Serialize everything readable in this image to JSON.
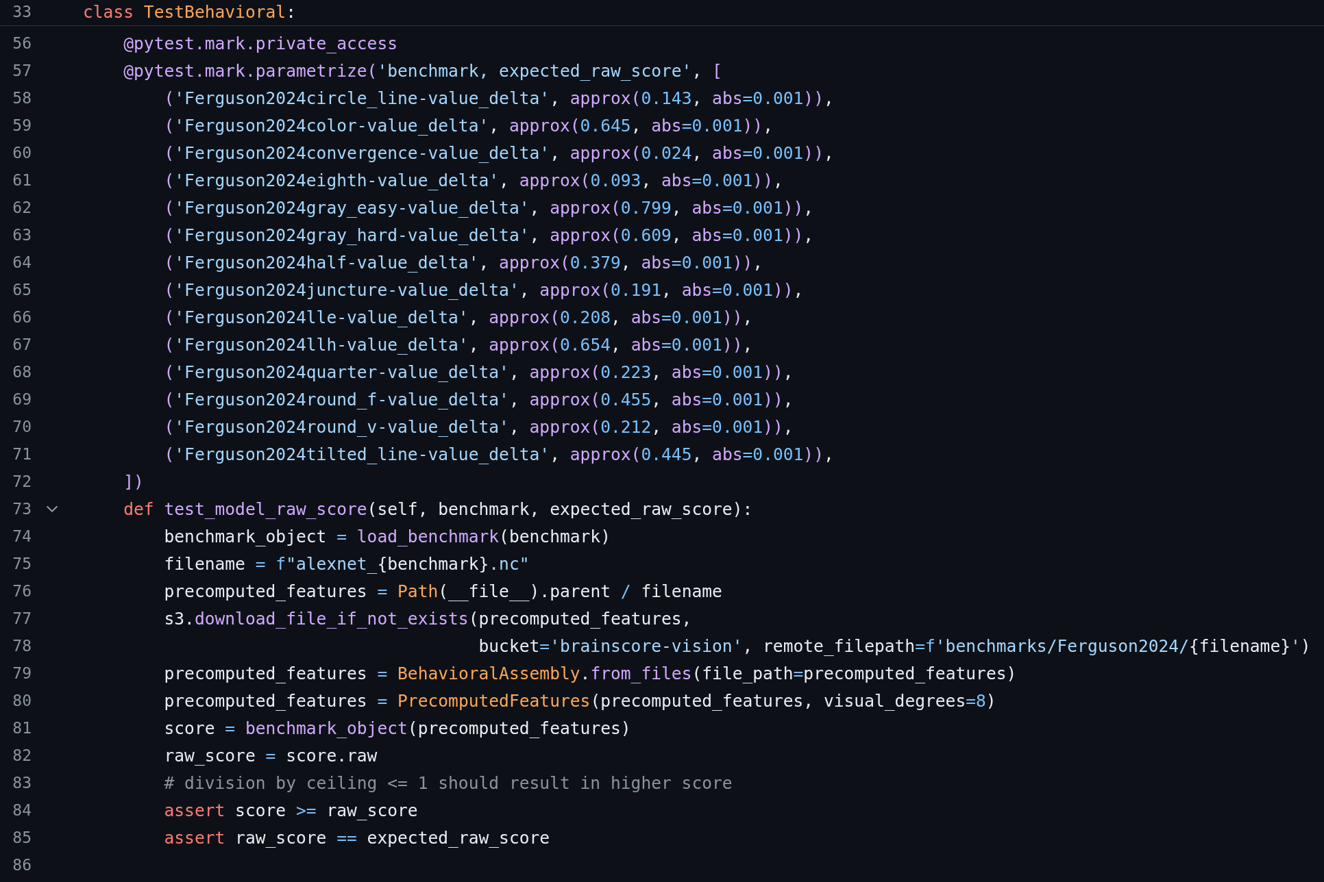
{
  "sticky_header": {
    "number": "33",
    "tokens": [
      {
        "kind": "kw",
        "text": "class "
      },
      {
        "kind": "type",
        "text": "TestBehavioral"
      },
      {
        "kind": "p",
        "text": ":"
      }
    ]
  },
  "lines": [
    {
      "number": "56",
      "tokens": [
        {
          "kind": "fn",
          "text": "    @pytest.mark.private_access"
        }
      ]
    },
    {
      "number": "57",
      "tokens": [
        {
          "kind": "fn",
          "text": "    @pytest.mark.parametrize("
        },
        {
          "kind": "str",
          "text": "'benchmark, expected_raw_score'"
        },
        {
          "kind": "p",
          "text": ", "
        },
        {
          "kind": "fn",
          "text": "["
        }
      ]
    },
    {
      "number": "58",
      "tokens": [
        {
          "kind": "fn",
          "text": "        ("
        },
        {
          "kind": "str",
          "text": "'Ferguson2024circle_line-value_delta'"
        },
        {
          "kind": "p",
          "text": ", "
        },
        {
          "kind": "fn",
          "text": "approx("
        },
        {
          "kind": "const",
          "text": "0.143"
        },
        {
          "kind": "p",
          "text": ", "
        },
        {
          "kind": "fn",
          "text": "abs"
        },
        {
          "kind": "const",
          "text": "=0.001"
        },
        {
          "kind": "fn",
          "text": "))"
        },
        {
          "kind": "p",
          "text": ","
        }
      ]
    },
    {
      "number": "59",
      "tokens": [
        {
          "kind": "fn",
          "text": "        ("
        },
        {
          "kind": "str",
          "text": "'Ferguson2024color-value_delta'"
        },
        {
          "kind": "p",
          "text": ", "
        },
        {
          "kind": "fn",
          "text": "approx("
        },
        {
          "kind": "const",
          "text": "0.645"
        },
        {
          "kind": "p",
          "text": ", "
        },
        {
          "kind": "fn",
          "text": "abs"
        },
        {
          "kind": "const",
          "text": "=0.001"
        },
        {
          "kind": "fn",
          "text": "))"
        },
        {
          "kind": "p",
          "text": ","
        }
      ]
    },
    {
      "number": "60",
      "tokens": [
        {
          "kind": "fn",
          "text": "        ("
        },
        {
          "kind": "str",
          "text": "'Ferguson2024convergence-value_delta'"
        },
        {
          "kind": "p",
          "text": ", "
        },
        {
          "kind": "fn",
          "text": "approx("
        },
        {
          "kind": "const",
          "text": "0.024"
        },
        {
          "kind": "p",
          "text": ", "
        },
        {
          "kind": "fn",
          "text": "abs"
        },
        {
          "kind": "const",
          "text": "=0.001"
        },
        {
          "kind": "fn",
          "text": "))"
        },
        {
          "kind": "p",
          "text": ","
        }
      ]
    },
    {
      "number": "61",
      "tokens": [
        {
          "kind": "fn",
          "text": "        ("
        },
        {
          "kind": "str",
          "text": "'Ferguson2024eighth-value_delta'"
        },
        {
          "kind": "p",
          "text": ", "
        },
        {
          "kind": "fn",
          "text": "approx("
        },
        {
          "kind": "const",
          "text": "0.093"
        },
        {
          "kind": "p",
          "text": ", "
        },
        {
          "kind": "fn",
          "text": "abs"
        },
        {
          "kind": "const",
          "text": "=0.001"
        },
        {
          "kind": "fn",
          "text": "))"
        },
        {
          "kind": "p",
          "text": ","
        }
      ]
    },
    {
      "number": "62",
      "tokens": [
        {
          "kind": "fn",
          "text": "        ("
        },
        {
          "kind": "str",
          "text": "'Ferguson2024gray_easy-value_delta'"
        },
        {
          "kind": "p",
          "text": ", "
        },
        {
          "kind": "fn",
          "text": "approx("
        },
        {
          "kind": "const",
          "text": "0.799"
        },
        {
          "kind": "p",
          "text": ", "
        },
        {
          "kind": "fn",
          "text": "abs"
        },
        {
          "kind": "const",
          "text": "=0.001"
        },
        {
          "kind": "fn",
          "text": "))"
        },
        {
          "kind": "p",
          "text": ","
        }
      ]
    },
    {
      "number": "63",
      "tokens": [
        {
          "kind": "fn",
          "text": "        ("
        },
        {
          "kind": "str",
          "text": "'Ferguson2024gray_hard-value_delta'"
        },
        {
          "kind": "p",
          "text": ", "
        },
        {
          "kind": "fn",
          "text": "approx("
        },
        {
          "kind": "const",
          "text": "0.609"
        },
        {
          "kind": "p",
          "text": ", "
        },
        {
          "kind": "fn",
          "text": "abs"
        },
        {
          "kind": "const",
          "text": "=0.001"
        },
        {
          "kind": "fn",
          "text": "))"
        },
        {
          "kind": "p",
          "text": ","
        }
      ]
    },
    {
      "number": "64",
      "tokens": [
        {
          "kind": "fn",
          "text": "        ("
        },
        {
          "kind": "str",
          "text": "'Ferguson2024half-value_delta'"
        },
        {
          "kind": "p",
          "text": ", "
        },
        {
          "kind": "fn",
          "text": "approx("
        },
        {
          "kind": "const",
          "text": "0.379"
        },
        {
          "kind": "p",
          "text": ", "
        },
        {
          "kind": "fn",
          "text": "abs"
        },
        {
          "kind": "const",
          "text": "=0.001"
        },
        {
          "kind": "fn",
          "text": "))"
        },
        {
          "kind": "p",
          "text": ","
        }
      ]
    },
    {
      "number": "65",
      "tokens": [
        {
          "kind": "fn",
          "text": "        ("
        },
        {
          "kind": "str",
          "text": "'Ferguson2024juncture-value_delta'"
        },
        {
          "kind": "p",
          "text": ", "
        },
        {
          "kind": "fn",
          "text": "approx("
        },
        {
          "kind": "const",
          "text": "0.191"
        },
        {
          "kind": "p",
          "text": ", "
        },
        {
          "kind": "fn",
          "text": "abs"
        },
        {
          "kind": "const",
          "text": "=0.001"
        },
        {
          "kind": "fn",
          "text": "))"
        },
        {
          "kind": "p",
          "text": ","
        }
      ]
    },
    {
      "number": "66",
      "tokens": [
        {
          "kind": "fn",
          "text": "        ("
        },
        {
          "kind": "str",
          "text": "'Ferguson2024lle-value_delta'"
        },
        {
          "kind": "p",
          "text": ", "
        },
        {
          "kind": "fn",
          "text": "approx("
        },
        {
          "kind": "const",
          "text": "0.208"
        },
        {
          "kind": "p",
          "text": ", "
        },
        {
          "kind": "fn",
          "text": "abs"
        },
        {
          "kind": "const",
          "text": "=0.001"
        },
        {
          "kind": "fn",
          "text": "))"
        },
        {
          "kind": "p",
          "text": ","
        }
      ]
    },
    {
      "number": "67",
      "tokens": [
        {
          "kind": "fn",
          "text": "        ("
        },
        {
          "kind": "str",
          "text": "'Ferguson2024llh-value_delta'"
        },
        {
          "kind": "p",
          "text": ", "
        },
        {
          "kind": "fn",
          "text": "approx("
        },
        {
          "kind": "const",
          "text": "0.654"
        },
        {
          "kind": "p",
          "text": ", "
        },
        {
          "kind": "fn",
          "text": "abs"
        },
        {
          "kind": "const",
          "text": "=0.001"
        },
        {
          "kind": "fn",
          "text": "))"
        },
        {
          "kind": "p",
          "text": ","
        }
      ]
    },
    {
      "number": "68",
      "tokens": [
        {
          "kind": "fn",
          "text": "        ("
        },
        {
          "kind": "str",
          "text": "'Ferguson2024quarter-value_delta'"
        },
        {
          "kind": "p",
          "text": ", "
        },
        {
          "kind": "fn",
          "text": "approx("
        },
        {
          "kind": "const",
          "text": "0.223"
        },
        {
          "kind": "p",
          "text": ", "
        },
        {
          "kind": "fn",
          "text": "abs"
        },
        {
          "kind": "const",
          "text": "=0.001"
        },
        {
          "kind": "fn",
          "text": "))"
        },
        {
          "kind": "p",
          "text": ","
        }
      ]
    },
    {
      "number": "69",
      "tokens": [
        {
          "kind": "fn",
          "text": "        ("
        },
        {
          "kind": "str",
          "text": "'Ferguson2024round_f-value_delta'"
        },
        {
          "kind": "p",
          "text": ", "
        },
        {
          "kind": "fn",
          "text": "approx("
        },
        {
          "kind": "const",
          "text": "0.455"
        },
        {
          "kind": "p",
          "text": ", "
        },
        {
          "kind": "fn",
          "text": "abs"
        },
        {
          "kind": "const",
          "text": "=0.001"
        },
        {
          "kind": "fn",
          "text": "))"
        },
        {
          "kind": "p",
          "text": ","
        }
      ]
    },
    {
      "number": "70",
      "tokens": [
        {
          "kind": "fn",
          "text": "        ("
        },
        {
          "kind": "str",
          "text": "'Ferguson2024round_v-value_delta'"
        },
        {
          "kind": "p",
          "text": ", "
        },
        {
          "kind": "fn",
          "text": "approx("
        },
        {
          "kind": "const",
          "text": "0.212"
        },
        {
          "kind": "p",
          "text": ", "
        },
        {
          "kind": "fn",
          "text": "abs"
        },
        {
          "kind": "const",
          "text": "=0.001"
        },
        {
          "kind": "fn",
          "text": "))"
        },
        {
          "kind": "p",
          "text": ","
        }
      ]
    },
    {
      "number": "71",
      "tokens": [
        {
          "kind": "fn",
          "text": "        ("
        },
        {
          "kind": "str",
          "text": "'Ferguson2024tilted_line-value_delta'"
        },
        {
          "kind": "p",
          "text": ", "
        },
        {
          "kind": "fn",
          "text": "approx("
        },
        {
          "kind": "const",
          "text": "0.445"
        },
        {
          "kind": "p",
          "text": ", "
        },
        {
          "kind": "fn",
          "text": "abs"
        },
        {
          "kind": "const",
          "text": "=0.001"
        },
        {
          "kind": "fn",
          "text": "))"
        },
        {
          "kind": "p",
          "text": ","
        }
      ]
    },
    {
      "number": "72",
      "tokens": [
        {
          "kind": "fn",
          "text": "    ])"
        }
      ]
    },
    {
      "number": "73",
      "fold": {
        "expanded": true
      },
      "tokens": [
        {
          "kind": "kw",
          "text": "    def "
        },
        {
          "kind": "fn",
          "text": "test_model_raw_score"
        },
        {
          "kind": "p",
          "text": "(self, benchmark, expected_raw_score):"
        }
      ]
    },
    {
      "number": "74",
      "tokens": [
        {
          "kind": "p",
          "text": "        benchmark_object "
        },
        {
          "kind": "const",
          "text": "= "
        },
        {
          "kind": "fn",
          "text": "load_benchmark"
        },
        {
          "kind": "p",
          "text": "(benchmark)"
        }
      ]
    },
    {
      "number": "75",
      "tokens": [
        {
          "kind": "p",
          "text": "        filename "
        },
        {
          "kind": "const",
          "text": "= f"
        },
        {
          "kind": "str",
          "text": "\"alexnet_"
        },
        {
          "kind": "p",
          "text": "{benchmark}"
        },
        {
          "kind": "str",
          "text": ".nc\""
        }
      ]
    },
    {
      "number": "76",
      "tokens": [
        {
          "kind": "p",
          "text": "        precomputed_features "
        },
        {
          "kind": "const",
          "text": "= "
        },
        {
          "kind": "type",
          "text": "Path"
        },
        {
          "kind": "p",
          "text": "(__file__).parent "
        },
        {
          "kind": "const",
          "text": "/"
        },
        {
          "kind": "p",
          "text": " filename"
        }
      ]
    },
    {
      "number": "77",
      "tokens": [
        {
          "kind": "p",
          "text": "        s3."
        },
        {
          "kind": "fn",
          "text": "download_file_if_not_exists"
        },
        {
          "kind": "p",
          "text": "(precomputed_features,"
        }
      ]
    },
    {
      "number": "78",
      "tokens": [
        {
          "kind": "p",
          "text": "                                       bucket"
        },
        {
          "kind": "const",
          "text": "="
        },
        {
          "kind": "str",
          "text": "'brainscore-vision'"
        },
        {
          "kind": "p",
          "text": ", remote_filepath"
        },
        {
          "kind": "const",
          "text": "="
        },
        {
          "kind": "const",
          "text": "f"
        },
        {
          "kind": "str",
          "text": "'benchmarks/Ferguson2024/"
        },
        {
          "kind": "p",
          "text": "{filename}"
        },
        {
          "kind": "str",
          "text": "'"
        },
        {
          "kind": "p",
          "text": ")"
        }
      ]
    },
    {
      "number": "79",
      "tokens": [
        {
          "kind": "p",
          "text": "        precomputed_features "
        },
        {
          "kind": "const",
          "text": "= "
        },
        {
          "kind": "type",
          "text": "BehavioralAssembly"
        },
        {
          "kind": "p",
          "text": "."
        },
        {
          "kind": "fn",
          "text": "from_files"
        },
        {
          "kind": "p",
          "text": "(file_path"
        },
        {
          "kind": "const",
          "text": "="
        },
        {
          "kind": "p",
          "text": "precomputed_features)"
        }
      ]
    },
    {
      "number": "80",
      "tokens": [
        {
          "kind": "p",
          "text": "        precomputed_features "
        },
        {
          "kind": "const",
          "text": "= "
        },
        {
          "kind": "type",
          "text": "PrecomputedFeatures"
        },
        {
          "kind": "p",
          "text": "(precomputed_features, visual_degrees"
        },
        {
          "kind": "const",
          "text": "=8"
        },
        {
          "kind": "p",
          "text": ")"
        }
      ]
    },
    {
      "number": "81",
      "tokens": [
        {
          "kind": "p",
          "text": "        score "
        },
        {
          "kind": "const",
          "text": "= "
        },
        {
          "kind": "fn",
          "text": "benchmark_object"
        },
        {
          "kind": "p",
          "text": "(precomputed_features)"
        }
      ]
    },
    {
      "number": "82",
      "tokens": [
        {
          "kind": "p",
          "text": "        raw_score "
        },
        {
          "kind": "const",
          "text": "="
        },
        {
          "kind": "p",
          "text": " score.raw"
        }
      ]
    },
    {
      "number": "83",
      "tokens": [
        {
          "kind": "cm",
          "text": "        # division by ceiling <= 1 should result in higher score"
        }
      ]
    },
    {
      "number": "84",
      "tokens": [
        {
          "kind": "kw",
          "text": "        assert"
        },
        {
          "kind": "p",
          "text": " score "
        },
        {
          "kind": "const",
          "text": ">="
        },
        {
          "kind": "p",
          "text": " raw_score"
        }
      ]
    },
    {
      "number": "85",
      "tokens": [
        {
          "kind": "kw",
          "text": "        assert"
        },
        {
          "kind": "p",
          "text": " raw_score "
        },
        {
          "kind": "const",
          "text": "=="
        },
        {
          "kind": "p",
          "text": " expected_raw_score"
        }
      ]
    },
    {
      "number": "86"
    }
  ]
}
